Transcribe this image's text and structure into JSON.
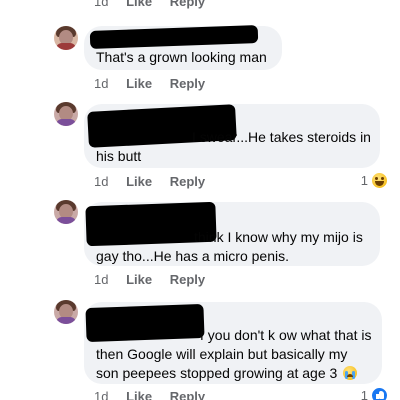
{
  "top_actions": {
    "time": "1d",
    "like": "Like",
    "reply": "Reply"
  },
  "comments": [
    {
      "lines": [
        "That's a grown looking man"
      ],
      "time": "1d",
      "like": "Like",
      "reply": "Reply",
      "reaction_count": ""
    },
    {
      "lines": [
        "I swear...He takes steroids in",
        "his butt"
      ],
      "time": "1d",
      "like": "Like",
      "reply": "Reply",
      "reaction_count": "1"
    },
    {
      "lines": [
        "think I know why my mijo is",
        "gay tho...He has a micro penis."
      ],
      "time": "1d",
      "like": "Like",
      "reply": "Reply",
      "reaction_count": ""
    },
    {
      "lines": [
        "f you don't k ow what that is",
        "then Google will explain but basically my",
        "son peepees stopped growing at age 3"
      ],
      "time": "1d",
      "like": "Like",
      "reply": "Reply",
      "reaction_count": "1"
    }
  ],
  "icons": {
    "laugh_reaction": "laugh-emoji-icon",
    "like_reaction": "like-reaction-icon",
    "crying_emoji": "crying-emoji-icon"
  },
  "colors": {
    "bubble_bg": "#f0f2f5",
    "meta_text": "#65676b",
    "like_blue": "#1877f2"
  }
}
